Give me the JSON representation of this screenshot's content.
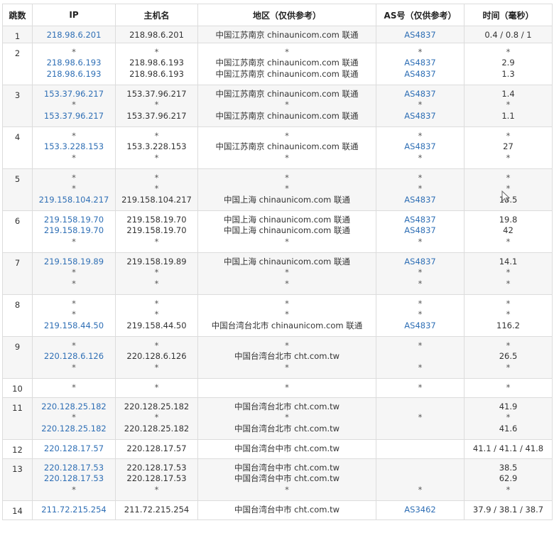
{
  "columns": [
    "跳数",
    "IP",
    "主机名",
    "地区（仅供参考）",
    "AS号（仅供参考）",
    "时间（毫秒）"
  ],
  "rows": [
    {
      "hop": "1",
      "h": 24,
      "ip": [
        "218.98.6.201"
      ],
      "host": [
        "218.98.6.201"
      ],
      "region": [
        "中国江苏南京 chinaunicom.com 联通"
      ],
      "as": [
        "AS4837"
      ],
      "time": [
        "0.4 / 0.8 / 1"
      ]
    },
    {
      "hop": "2",
      "h": 59,
      "ip": [
        "*",
        "218.98.6.193",
        "218.98.6.193"
      ],
      "host": [
        "*",
        "218.98.6.193",
        "218.98.6.193"
      ],
      "region": [
        "*",
        "中国江苏南京 chinaunicom.com 联通",
        "中国江苏南京 chinaunicom.com 联通"
      ],
      "as": [
        "*",
        "AS4837",
        "AS4837"
      ],
      "time": [
        "*",
        "2.9",
        "1.3"
      ]
    },
    {
      "hop": "3",
      "h": 59,
      "ip": [
        "153.37.96.217",
        "*",
        "153.37.96.217"
      ],
      "host": [
        "153.37.96.217",
        "*",
        "153.37.96.217"
      ],
      "region": [
        "中国江苏南京 chinaunicom.com 联通",
        "*",
        "中国江苏南京 chinaunicom.com 联通"
      ],
      "as": [
        "AS4837",
        "*",
        "AS4837"
      ],
      "time": [
        "1.4",
        "*",
        "1.1"
      ]
    },
    {
      "hop": "4",
      "h": 59,
      "ip": [
        "*",
        "153.3.228.153",
        "*"
      ],
      "host": [
        "*",
        "153.3.228.153",
        "*"
      ],
      "region": [
        "*",
        "中国江苏南京 chinaunicom.com 联通",
        "*"
      ],
      "as": [
        "*",
        "AS4837",
        "*"
      ],
      "time": [
        "*",
        "27",
        "*"
      ]
    },
    {
      "hop": "5",
      "h": 59,
      "ip": [
        "*",
        "*",
        "219.158.104.217"
      ],
      "host": [
        "*",
        "*",
        "219.158.104.217"
      ],
      "region": [
        "*",
        "*",
        "中国上海 chinaunicom.com 联通"
      ],
      "as": [
        "*",
        "*",
        "AS4837"
      ],
      "time": [
        "*",
        "*",
        "18.5"
      ]
    },
    {
      "hop": "6",
      "h": 59,
      "ip": [
        "219.158.19.70",
        "219.158.19.70",
        "*"
      ],
      "host": [
        "219.158.19.70",
        "219.158.19.70",
        "*"
      ],
      "region": [
        "中国上海 chinaunicom.com 联通",
        "中国上海 chinaunicom.com 联通",
        "*"
      ],
      "as": [
        "AS4837",
        "AS4837",
        "*"
      ],
      "time": [
        "19.8",
        "42",
        "*"
      ]
    },
    {
      "hop": "7",
      "h": 59,
      "ip": [
        "219.158.19.89",
        "*",
        "*"
      ],
      "host": [
        "219.158.19.89",
        "*",
        "*"
      ],
      "region": [
        "中国上海 chinaunicom.com 联通",
        "*",
        "*"
      ],
      "as": [
        "AS4837",
        "*",
        "*"
      ],
      "time": [
        "14.1",
        "*",
        "*"
      ]
    },
    {
      "hop": "8",
      "h": 59,
      "ip": [
        "*",
        "*",
        "219.158.44.50"
      ],
      "host": [
        "*",
        "*",
        "219.158.44.50"
      ],
      "region": [
        "*",
        "*",
        "中国台湾台北市 chinaunicom.com 联通"
      ],
      "as": [
        "*",
        "*",
        "AS4837"
      ],
      "time": [
        "*",
        "*",
        "116.2"
      ]
    },
    {
      "hop": "9",
      "h": 59,
      "ip": [
        "*",
        "220.128.6.126",
        "*"
      ],
      "host": [
        "*",
        "220.128.6.126",
        "*"
      ],
      "region": [
        "*",
        "中国台湾台北市 cht.com.tw",
        "*"
      ],
      "as": [
        "*",
        "",
        "*"
      ],
      "time": [
        "*",
        "26.5",
        "*"
      ]
    },
    {
      "hop": "10",
      "h": 27,
      "ip": [
        "*"
      ],
      "host": [
        "*"
      ],
      "region": [
        "*"
      ],
      "as": [
        "*"
      ],
      "time": [
        "*"
      ]
    },
    {
      "hop": "11",
      "h": 59,
      "ip": [
        "220.128.25.182",
        "*",
        "220.128.25.182"
      ],
      "host": [
        "220.128.25.182",
        "*",
        "220.128.25.182"
      ],
      "region": [
        "中国台湾台北市 cht.com.tw",
        "*",
        "中国台湾台北市 cht.com.tw"
      ],
      "as": [
        "",
        "*",
        ""
      ],
      "time": [
        "41.9",
        "*",
        "41.6"
      ]
    },
    {
      "hop": "12",
      "h": 27,
      "ip": [
        "220.128.17.57"
      ],
      "host": [
        "220.128.17.57"
      ],
      "region": [
        "中国台湾台中市 cht.com.tw"
      ],
      "as": [
        ""
      ],
      "time": [
        "41.1 / 41.1 / 41.8"
      ]
    },
    {
      "hop": "13",
      "h": 59,
      "ip": [
        "220.128.17.53",
        "220.128.17.53",
        "*"
      ],
      "host": [
        "220.128.17.53",
        "220.128.17.53",
        "*"
      ],
      "region": [
        "中国台湾台中市 cht.com.tw",
        "中国台湾台中市 cht.com.tw",
        "*"
      ],
      "as": [
        "",
        "",
        "*"
      ],
      "time": [
        "38.5",
        "62.9",
        "*"
      ]
    },
    {
      "hop": "14",
      "h": 27,
      "ip": [
        "211.72.215.254"
      ],
      "host": [
        "211.72.215.254"
      ],
      "region": [
        "中国台湾台中市 cht.com.tw"
      ],
      "as": [
        "AS3462"
      ],
      "time": [
        "37.9 / 38.1 / 38.7"
      ]
    }
  ],
  "colors": {
    "link": "#2f6fb5",
    "border": "#dcdcdc",
    "stripe": "#f6f6f6"
  },
  "icons": {
    "cursor": "mouse-pointer-icon"
  }
}
